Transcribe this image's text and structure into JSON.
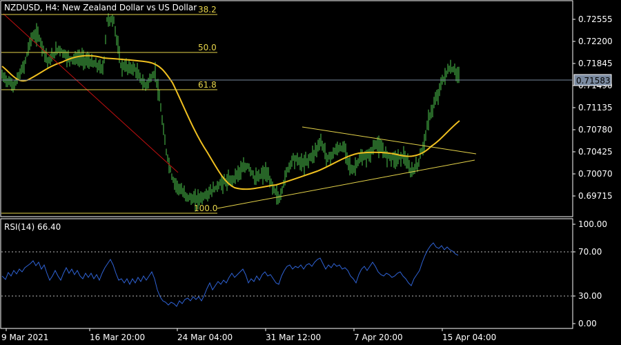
{
  "header": {
    "title": "NZDUSD, H4:  New Zealand Dollar vs US Dollar"
  },
  "colors": {
    "background": "#000000",
    "frame": "#ffffff",
    "candle": "#4ec94e",
    "ma": "#f0c020",
    "fib": "#e6d44a",
    "trendline": "#c01010",
    "triangle": "#e6d44a",
    "rsi": "#2f63d6",
    "price_line": "#7a8aa0",
    "grid_dotted": "#bbbbbb"
  },
  "price_panel": {
    "price_axis_labels": [
      "0.72555",
      "0.72200",
      "0.71845",
      "0.71490",
      "0.71135",
      "0.70780",
      "0.70425",
      "0.70070",
      "0.69715"
    ],
    "current_price_label": "0.71583",
    "fib_levels": [
      {
        "label": "38.2"
      },
      {
        "label": "50.0"
      },
      {
        "label": "61.8"
      },
      {
        "label": "100.0"
      }
    ]
  },
  "rsi_panel": {
    "title": "RSI(14) 66.40",
    "axis_labels": [
      "100.00",
      "70.00",
      "30.00",
      "0.00"
    ]
  },
  "time_axis": {
    "labels": [
      "9 Mar 2021",
      "16 Mar 20:00",
      "24 Mar 04:00",
      "31 Mar 12:00",
      "7 Apr 20:00",
      "15 Apr 04:00"
    ]
  },
  "chart_data": {
    "type": "line",
    "series": [
      {
        "name": "NZDUSD",
        "x_index": [
          0,
          10,
          20,
          30,
          40,
          50,
          60,
          70,
          80,
          90,
          100,
          110,
          120,
          130
        ],
        "values": [
          0.7185,
          0.7245,
          0.718,
          0.714,
          0.699,
          0.6985,
          0.7005,
          0.704,
          0.705,
          0.702,
          0.704,
          0.701,
          0.714,
          0.7165
        ]
      },
      {
        "name": "RSI(14)",
        "x_index": [
          0,
          13,
          26,
          39,
          52,
          65,
          78,
          91,
          104,
          117,
          130
        ],
        "values": [
          48,
          55,
          45,
          25,
          32,
          54,
          60,
          54,
          52,
          78,
          66.4
        ]
      }
    ],
    "xlabel": "",
    "ylabel": "",
    "ylim_price": [
      0.6955,
      0.728
    ],
    "ylim_rsi": [
      0,
      100
    ]
  }
}
